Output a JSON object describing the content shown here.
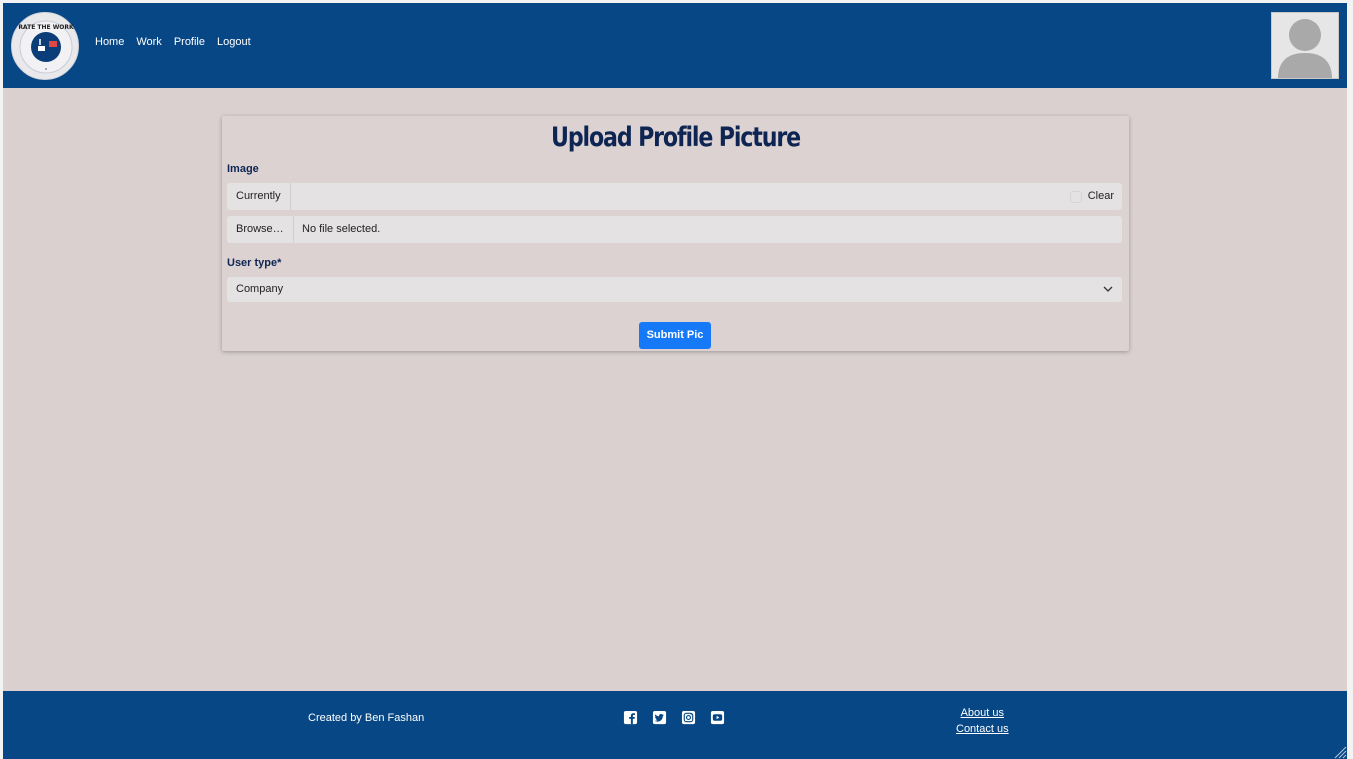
{
  "nav": {
    "links": [
      "Home",
      "Work",
      "Profile",
      "Logout"
    ],
    "logo_text": "RATE THE WORK"
  },
  "form": {
    "title": "Upload Profile Picture",
    "image_label": "Image",
    "currently_label": "Currently",
    "clear_label": "Clear",
    "browse_label": "Browse…",
    "file_status": "No file selected.",
    "user_type_label": "User type*",
    "user_type_value": "Company",
    "submit_label": "Submit Pic"
  },
  "footer": {
    "credit": "Created by Ben Fashan",
    "socials": [
      "facebook-icon",
      "twitter-icon",
      "instagram-icon",
      "youtube-icon"
    ],
    "about": "About us",
    "contact": "Contact us"
  },
  "colors": {
    "brand": "#074785",
    "background": "#dad0d0",
    "title": "#0e2553",
    "button": "#1679f8"
  }
}
